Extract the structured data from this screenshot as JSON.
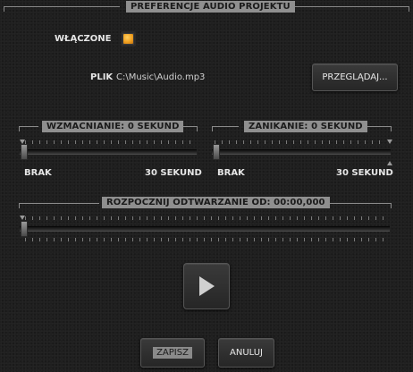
{
  "header": {
    "title": "PREFERENCJE AUDIO PROJEKTU"
  },
  "enabled": {
    "label": "WŁĄCZONE",
    "checked": true,
    "color": "#f0a020"
  },
  "file": {
    "label": "PLIK",
    "path": "C:\\Music\\Audio.mp3",
    "browse_label": "PRZEGLĄDAJ..."
  },
  "fade_in": {
    "title": "WZMACNIANIE: 0 SEKUND",
    "min_label": "BRAK",
    "max_label": "30 SEKUND",
    "value_fraction": 0
  },
  "fade_out": {
    "title": "ZANIKANIE: 0 SEKUND",
    "min_label": "BRAK",
    "max_label": "30 SEKUND",
    "value_fraction": 0
  },
  "start_from": {
    "title": "ROZPOCZNIJ ODTWARZANIE OD: 00:00,000",
    "value_fraction": 0
  },
  "play": {
    "icon": "play-icon"
  },
  "footer": {
    "save_label": "ZAPISZ",
    "cancel_label": "ANULUJ"
  }
}
